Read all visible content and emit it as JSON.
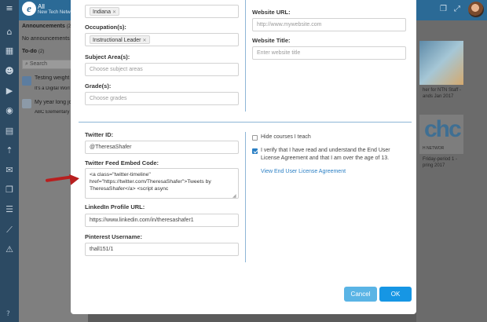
{
  "app": {
    "title": "All",
    "subtitle": "New Tech Netwo"
  },
  "left_panel": {
    "announcements_header": "Announcements",
    "announcements_count": "(2)",
    "no_announcements": "No announcements",
    "todo_header": "To-do",
    "todo_count": "(2)",
    "search_placeholder": "Search",
    "items": [
      {
        "title": "Testing weight",
        "subtitle": "It's a Digital Worl"
      },
      {
        "title": "My year long jo",
        "subtitle": "ABC Elementary"
      }
    ]
  },
  "background_cards": [
    {
      "caption_line1": "her for NTN Staff -",
      "caption_line2": "ands Jan 2017"
    },
    {
      "logo_text": "chc",
      "caption_line0": "H NETWOR",
      "caption_line1": "Friday-period 1 -",
      "caption_line2": "pring 2017"
    }
  ],
  "modal": {
    "location": {
      "tag": "Indiana"
    },
    "occupation": {
      "label": "Occupation(s):",
      "tag": "Instructional Leader"
    },
    "subject_areas": {
      "label": "Subject Area(s):",
      "placeholder": "Choose subject areas"
    },
    "grades": {
      "label": "Grade(s):",
      "placeholder": "Choose grades"
    },
    "website_url": {
      "label": "Website URL:",
      "placeholder": "http://www.mywebsite.com"
    },
    "website_title": {
      "label": "Website Title:",
      "placeholder": "Enter website title"
    },
    "twitter_id": {
      "label": "Twitter ID:",
      "value": "@TheresaShafer"
    },
    "twitter_embed": {
      "label": "Twitter Feed Embed Code:",
      "value_line1": "<a class=\"twitter-timeline\"",
      "value_line2": "href=\"https://twitter.com/TheresaShafer\">Tweets by",
      "value_line3": "TheresaShafer</a> <script async"
    },
    "linkedin": {
      "label": "LinkedIn Profile URL:",
      "value": "https://www.linkedin.com/in/theresashafer1"
    },
    "pinterest": {
      "label": "Pinterest Username:",
      "value": "thall151/1"
    },
    "hide_courses": {
      "label": "Hide courses I teach",
      "checked": false
    },
    "verify": {
      "label_line1": "I verify that I have read and understand the End User",
      "label_line2": "License Agreement and that I am over the age of 13.",
      "checked": true
    },
    "eula_link": "View End User License Agreement",
    "cancel_label": "Cancel",
    "ok_label": "OK"
  },
  "colors": {
    "accent": "#1696e4",
    "accent_light": "#5ab4e5",
    "topbar": "#2b6a96",
    "rail": "#2c4a63",
    "arrow": "#b81f1f"
  },
  "icons": [
    "menu-icon",
    "home-icon",
    "calendar-icon",
    "users-icon",
    "play-icon",
    "palette-icon",
    "document-icon",
    "user-upload-icon",
    "mail-icon",
    "files-icon",
    "list-icon",
    "chart-icon",
    "warning-icon",
    "help-icon",
    "copy-icon",
    "expand-icon"
  ]
}
